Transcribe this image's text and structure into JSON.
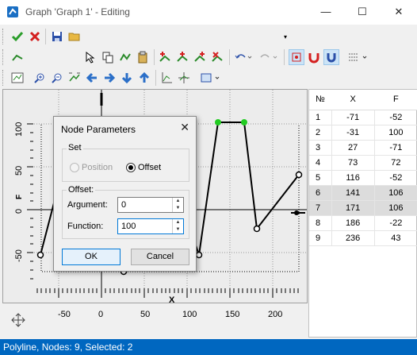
{
  "window": {
    "title": "Graph 'Graph 1' - Editing",
    "minimize": "—",
    "maximize": "☐",
    "close": "✕"
  },
  "toolbar": {
    "accent": "#0078d7",
    "combo_value": ""
  },
  "plot": {
    "x_label": "X",
    "y_label": "F",
    "x_ticks": [
      "-50",
      "0",
      "50",
      "100",
      "150",
      "200"
    ],
    "y_ticks": [
      "100",
      "50",
      "0",
      "-50"
    ]
  },
  "table": {
    "headers": [
      "№",
      "X",
      "F"
    ],
    "rows": [
      [
        "1",
        "-71",
        "-52"
      ],
      [
        "2",
        "-31",
        "100"
      ],
      [
        "3",
        "27",
        "-71"
      ],
      [
        "4",
        "73",
        "72"
      ],
      [
        "5",
        "116",
        "-52"
      ],
      [
        "6",
        "141",
        "106"
      ],
      [
        "7",
        "171",
        "106"
      ],
      [
        "8",
        "186",
        "-22"
      ],
      [
        "9",
        "236",
        "43"
      ]
    ],
    "selected_rows": [
      6,
      7
    ]
  },
  "dialog": {
    "title": "Node Parameters",
    "set_group": "Set",
    "position_label": "Position",
    "offset_label": "Offset",
    "offset_group": "Offset:",
    "argument_label": "Argument:",
    "argument_value": "0",
    "function_label": "Function:",
    "function_value": "100",
    "ok_label": "OK",
    "cancel_label": "Cancel"
  },
  "status": {
    "text": "Polyline, Nodes: 9, Selected: 2"
  }
}
